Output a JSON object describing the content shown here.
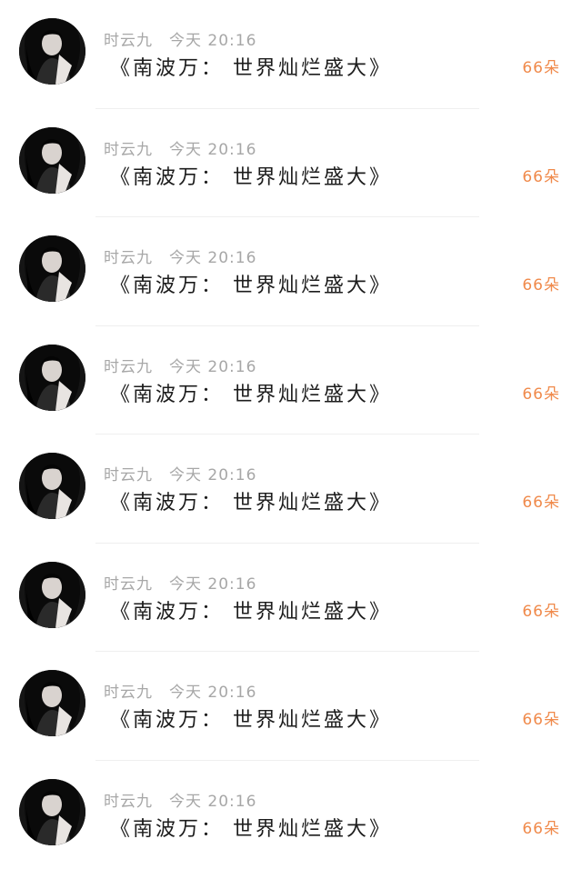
{
  "messages": [
    {
      "sender": "时云九",
      "time": "今天 20:16",
      "text": "《南波万：  世界灿烂盛大》",
      "count": "66朵"
    },
    {
      "sender": "时云九",
      "time": "今天 20:16",
      "text": "《南波万：  世界灿烂盛大》",
      "count": "66朵"
    },
    {
      "sender": "时云九",
      "time": "今天 20:16",
      "text": "《南波万：  世界灿烂盛大》",
      "count": "66朵"
    },
    {
      "sender": "时云九",
      "time": "今天 20:16",
      "text": "《南波万：  世界灿烂盛大》",
      "count": "66朵"
    },
    {
      "sender": "时云九",
      "time": "今天 20:16",
      "text": "《南波万：  世界灿烂盛大》",
      "count": "66朵"
    },
    {
      "sender": "时云九",
      "time": "今天 20:16",
      "text": "《南波万：  世界灿烂盛大》",
      "count": "66朵"
    },
    {
      "sender": "时云九",
      "time": "今天 20:16",
      "text": "《南波万：  世界灿烂盛大》",
      "count": "66朵"
    },
    {
      "sender": "时云九",
      "time": "今天 20:16",
      "text": "《南波万：  世界灿烂盛大》",
      "count": "66朵"
    }
  ],
  "colors": {
    "name_time": "#a7a7a7",
    "text": "#1c1c1c",
    "count": "#f08a4b",
    "divider": "#efefef"
  }
}
